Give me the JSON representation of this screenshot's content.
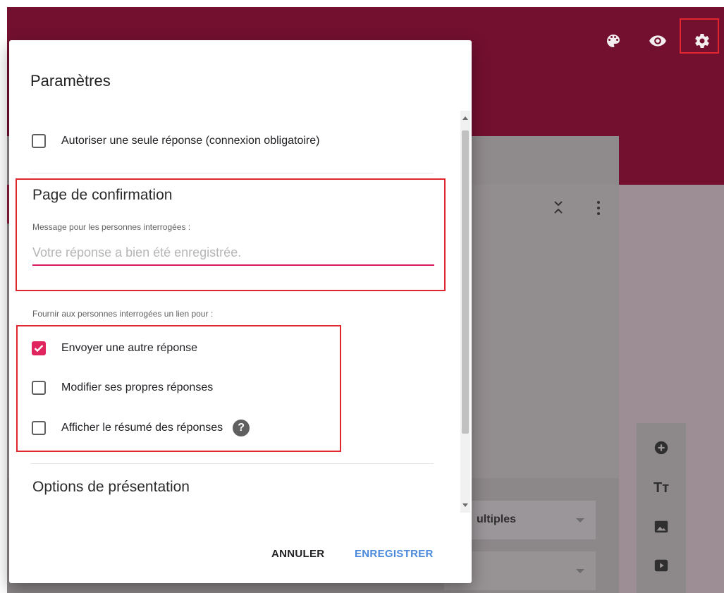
{
  "background": {
    "toolbar_icons": [
      "palette-icon",
      "eye-icon",
      "gear-icon"
    ],
    "select_1": "ultiples",
    "tools": [
      "add-circle-icon",
      "text-size-icon",
      "image-icon",
      "video-icon"
    ],
    "text_size_glyph": "Tт"
  },
  "dialog": {
    "title": "Paramètres",
    "single_response_label": "Autoriser une seule réponse (connexion obligatoire)",
    "confirmation": {
      "heading": "Page de confirmation",
      "message_label": "Message pour les personnes interrogées :",
      "message_placeholder": "Votre réponse a bien été enregistrée."
    },
    "links": {
      "heading": "Fournir aux personnes interrogées un lien pour :",
      "items": [
        {
          "label": "Envoyer une autre réponse",
          "checked": true
        },
        {
          "label": "Modifier ses propres réponses",
          "checked": false
        },
        {
          "label": "Afficher le résumé des réponses",
          "checked": false
        }
      ],
      "help_glyph": "?"
    },
    "presentation_heading": "Options de présentation",
    "cancel_label": "ANNULER",
    "save_label": "ENREGISTRER"
  },
  "colors": {
    "header": "#73102f",
    "checkbox_accent": "#e0245e",
    "field_underline": "#d81b60",
    "save_button": "#4a89dc",
    "highlight_box": "#e0262e"
  }
}
